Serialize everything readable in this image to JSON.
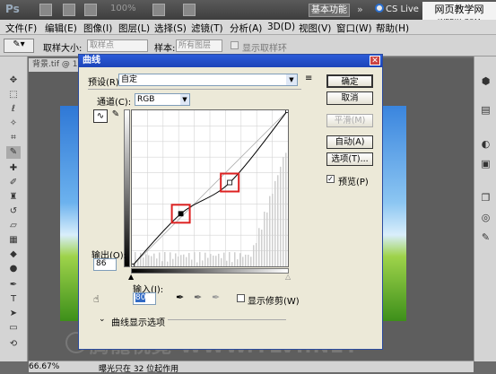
{
  "app": {
    "logo": "Ps",
    "zoom": "100%",
    "workspace_button": "基本功能",
    "cs_live": "CS Live"
  },
  "site": {
    "title": "网页教学网",
    "url": "WEBJX.COM"
  },
  "menu": [
    "文件(F)",
    "编辑(E)",
    "图像(I)",
    "图层(L)",
    "选择(S)",
    "滤镜(T)",
    "分析(A)",
    "3D(D)",
    "视图(V)",
    "窗口(W)",
    "帮助(H)"
  ],
  "options": {
    "sample_size_label": "取样大小:",
    "sample_size_value": "取样点",
    "sample_label": "样本:",
    "sample_value": "所有图层",
    "show_ring": "显示取样环"
  },
  "document": {
    "tab": "背景.tif @ 10"
  },
  "status": {
    "zoom": "66.67%",
    "message": "曝光只在 32 位起作用"
  },
  "dialog": {
    "title": "曲线",
    "preset_label": "预设(R):",
    "preset_value": "自定",
    "channel_label": "通道(C):",
    "channel_value": "RGB",
    "buttons": {
      "ok": "确定",
      "cancel": "取消",
      "smooth": "平滑(M)",
      "auto": "自动(A)",
      "options": "选项(T)..."
    },
    "preview_label": "预览(P)",
    "output_label": "输出(O):",
    "output_value": "86",
    "input_label": "输入(I):",
    "input_value": "80",
    "show_clipping": "显示修剪(W)",
    "curve_display_options": "曲线显示选项",
    "curve_points": [
      {
        "input": 0,
        "output": 0
      },
      {
        "input": 80,
        "output": 86
      },
      {
        "input": 160,
        "output": 137
      },
      {
        "input": 255,
        "output": 255
      }
    ]
  },
  "watermark": "腾龍視覺 WWW.TLVI.NET",
  "colors": {
    "title_blue": "#1d44b8",
    "highlight_red": "#d22"
  }
}
